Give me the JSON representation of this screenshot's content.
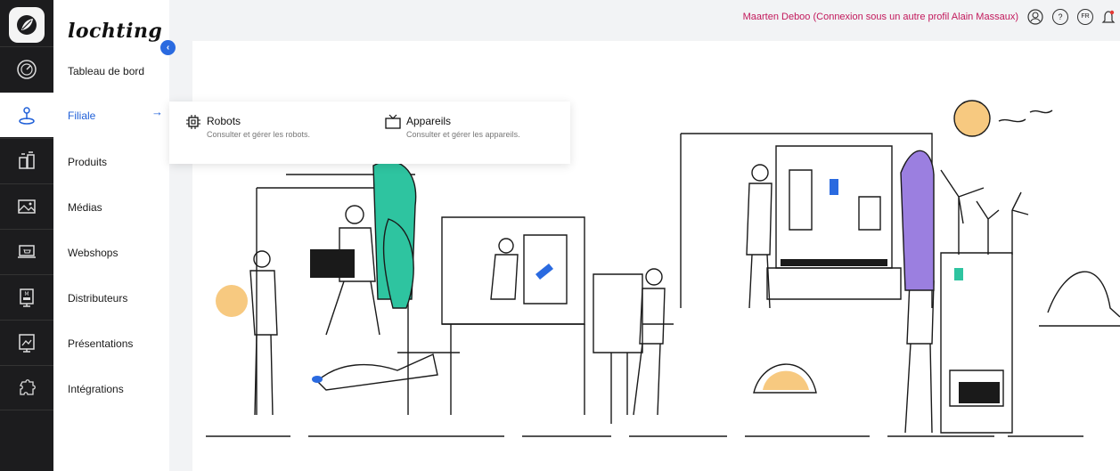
{
  "brand": {
    "name": "lochting"
  },
  "rail": {
    "icons": [
      "leaf-logo-icon",
      "dashboard-gauge-icon",
      "location-pin-icon",
      "products-icon",
      "media-icon",
      "webshop-icon",
      "distributor-icon",
      "presentation-icon",
      "integrations-puzzle-icon"
    ]
  },
  "nav": {
    "items": [
      {
        "label": "Tableau de bord"
      },
      {
        "label": "Filiale"
      },
      {
        "label": "Produits"
      },
      {
        "label": "Médias"
      },
      {
        "label": "Webshops"
      },
      {
        "label": "Distributeurs"
      },
      {
        "label": "Présentations"
      },
      {
        "label": "Intégrations"
      }
    ],
    "active_arrow": "→",
    "collapse": "‹"
  },
  "topbar": {
    "user": "Maarten Deboo (Connexion sous un autre profil Alain Massaux)",
    "lang": "FR",
    "help": "?"
  },
  "dropdown": {
    "items": [
      {
        "title": "Robots",
        "desc": "Consulter et gérer les robots.",
        "icon": "chip-icon"
      },
      {
        "title": "Appareils",
        "desc": "Consulter et gérer les appareils.",
        "icon": "tv-icon"
      }
    ]
  },
  "colors": {
    "accent": "#2060d8",
    "user": "#c2185b",
    "rail": "#1c1c1e",
    "teal": "#2ec4a0",
    "purple": "#9b7fe0",
    "sun": "#f7c980"
  }
}
